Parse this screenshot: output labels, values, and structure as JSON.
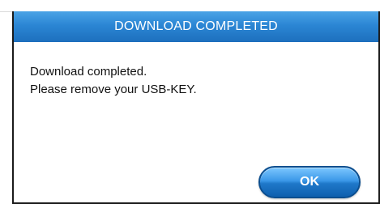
{
  "dialog": {
    "title": "DOWNLOAD COMPLETED",
    "message_line_1": "Download completed.",
    "message_line_2": "Please remove your USB-KEY.",
    "ok_label": "OK"
  },
  "colors": {
    "title_bar": "#2b86d4",
    "ok_button": "#1f78c9",
    "border": "#1a1a1a",
    "background": "#ffffff"
  }
}
